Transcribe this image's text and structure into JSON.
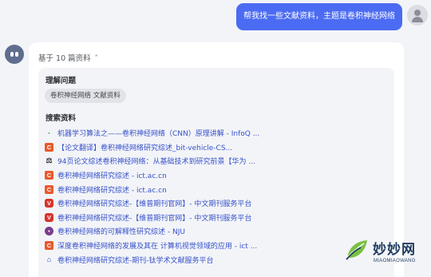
{
  "user_message": "帮我找一些文献资料，主题是卷积神经网络",
  "sources_toggle": {
    "label": "基于 10 篇资料",
    "icon": "chevron-up-icon"
  },
  "understanding": {
    "title": "理解问题",
    "query_chip": "卷积神经网络 文献资料"
  },
  "search": {
    "title": "搜索资料",
    "results": [
      {
        "site_icon": "infoq-icon",
        "title": "机器学习算法之——卷积神经网络（CNN）原理讲解 - InfoQ ..."
      },
      {
        "site_icon": "csdn-icon",
        "title": "【论文翻译】卷积神经网络研究综述_bit-vehicle-CS..."
      },
      {
        "site_icon": "doc-icon",
        "title": "94页论文综述卷积神经网络：从基础技术到研究前景【华为 ..."
      },
      {
        "site_icon": "ict-icon",
        "title": "卷积神经网络研究综述 - ict.ac.cn"
      },
      {
        "site_icon": "ict-icon",
        "title": "卷积神经网络研究综述 - ict.ac.cn"
      },
      {
        "site_icon": "vip-icon",
        "title": "卷积神经网络研究综述-【维普期刊官网】- 中文期刊服务平台"
      },
      {
        "site_icon": "vip-icon",
        "title": "卷积神经网络研究综述-【维普期刊官网】- 中文期刊服务平台"
      },
      {
        "site_icon": "nju-icon",
        "title": "卷积神经网络的可解释性研究综述 - NJU"
      },
      {
        "site_icon": "csdn-icon",
        "title": "深度卷积神经网络的发展及其在 计算机视觉领域的应用 - ict ..."
      },
      {
        "site_icon": "cap-icon",
        "title": "卷积神经网络研究综述-期刊-钛学术文献服务平台"
      }
    ]
  },
  "watermark": {
    "name": "妙妙网",
    "sub": "MIAOMIAOWANG"
  },
  "colors": {
    "accent": "#4b6bf2",
    "link": "#3551c9",
    "panel": "#f3f4f8"
  }
}
